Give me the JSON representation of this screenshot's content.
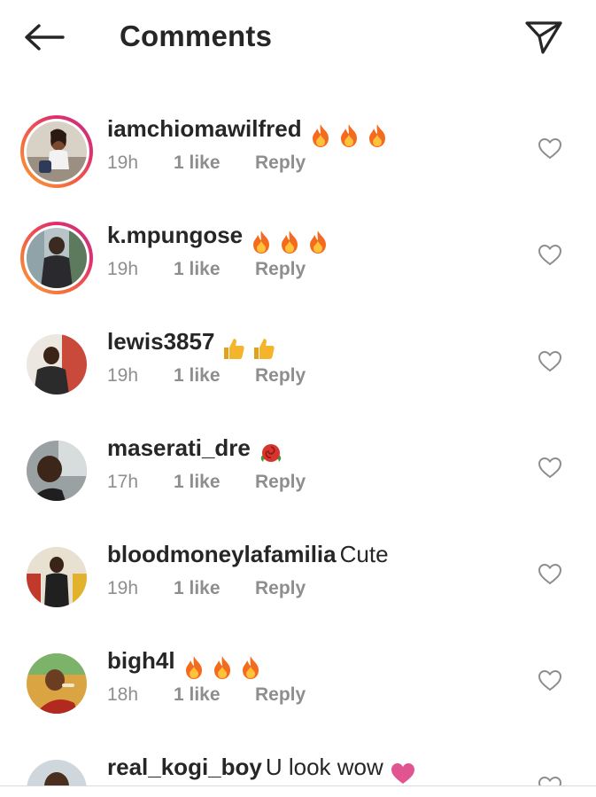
{
  "header": {
    "title": "Comments",
    "back_icon": "arrow-left-icon",
    "share_icon": "paper-plane-icon"
  },
  "colors": {
    "text": "#262626",
    "muted": "#8e8e8e",
    "fire": "#f46b1f",
    "thumb": "#f5b52b",
    "heart_emoji": "#e0558f"
  },
  "comments": [
    {
      "username": "iamchiomawilfred",
      "text": "",
      "emojis": [
        "fire-emoji",
        "fire-emoji",
        "fire-emoji"
      ],
      "time": "19h",
      "likes": "1 like",
      "reply": "Reply",
      "has_story": true
    },
    {
      "username": "k.mpungose",
      "text": "",
      "emojis": [
        "fire-emoji",
        "fire-emoji",
        "fire-emoji"
      ],
      "time": "19h",
      "likes": "1 like",
      "reply": "Reply",
      "has_story": true
    },
    {
      "username": "lewis3857",
      "text": "",
      "emojis": [
        "thumbs-up-emoji",
        "thumbs-up-emoji"
      ],
      "time": "19h",
      "likes": "1 like",
      "reply": "Reply",
      "has_story": false
    },
    {
      "username": "maserati_dre",
      "text": "",
      "emojis": [
        "rose-emoji"
      ],
      "time": "17h",
      "likes": "1 like",
      "reply": "Reply",
      "has_story": false
    },
    {
      "username": "bloodmoneylafamilia",
      "text": "Cute",
      "emojis": [],
      "time": "19h",
      "likes": "1 like",
      "reply": "Reply",
      "has_story": false
    },
    {
      "username": "bigh4l",
      "text": "",
      "emojis": [
        "fire-emoji",
        "fire-emoji",
        "fire-emoji"
      ],
      "time": "18h",
      "likes": "1 like",
      "reply": "Reply",
      "has_story": false
    },
    {
      "username": "real_kogi_boy",
      "text": "U look wow",
      "emojis": [
        "pink-heart-emoji"
      ],
      "time": "",
      "likes": "",
      "reply": "",
      "has_story": false
    }
  ]
}
